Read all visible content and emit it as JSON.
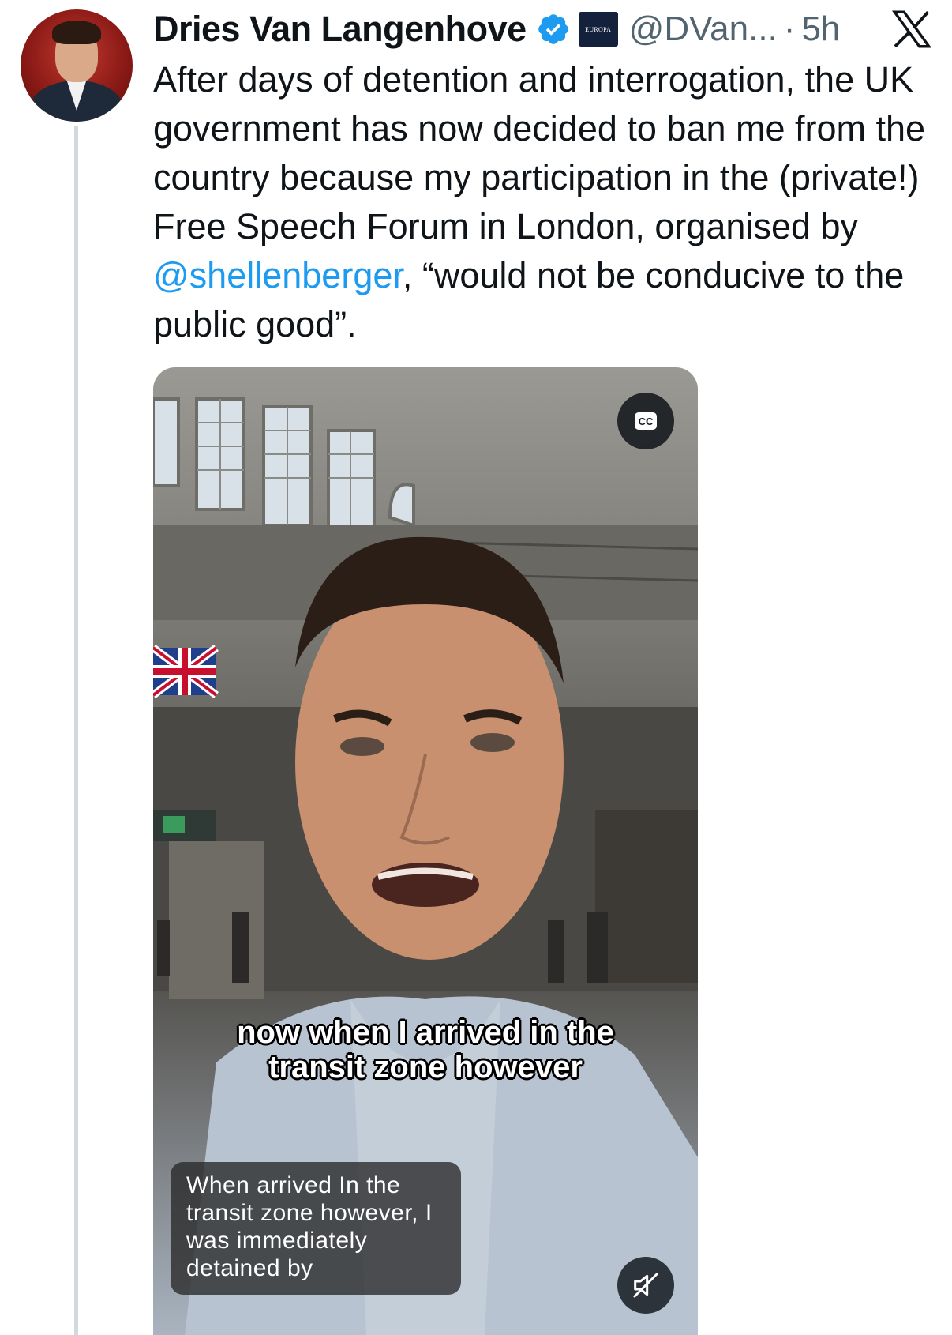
{
  "author": {
    "name": "Dries Van Langenhove",
    "handle": "@DVan...",
    "separator": "·",
    "time": "5h",
    "affiliate_badge_text": "EUROPA"
  },
  "tweet": {
    "text_before_mention": "After days of detention and interrogation, the UK government has now decided to ban me from the country because my participation in the (private!) Free Speech Forum in London, organised by ",
    "mention": "@shellenberger",
    "text_after_mention": ", “would not be conducive to the public good”."
  },
  "video": {
    "burned_caption_line1": "now when I arrived in the",
    "burned_caption_line2": "transit zone however",
    "closed_caption": "When arrived In the transit zone however, I was immediately detained by",
    "cc_label": "CC"
  },
  "icons": {
    "verified": "verified-badge-icon",
    "x_logo": "x-logo-icon",
    "cc": "closed-captions-icon",
    "mute": "muted-speaker-icon"
  },
  "colors": {
    "accent": "#1d9bf0",
    "secondary_text": "#536471",
    "primary_text": "#0f1419"
  }
}
